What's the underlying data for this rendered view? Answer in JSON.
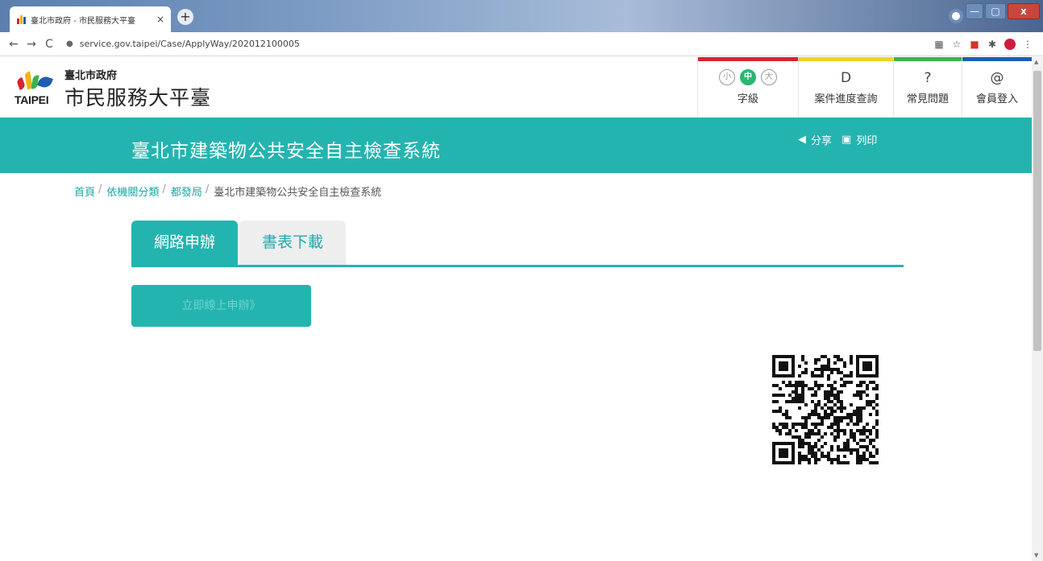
{
  "browser": {
    "tab_title": "臺北市政府 - 市民服務大平臺",
    "tab_close": "×",
    "new_tab": "+",
    "url": "service.gov.taipei/Case/ApplyWay/202012100005",
    "nav": {
      "back": "←",
      "forward": "→",
      "reload": "C",
      "lock": "🔒"
    },
    "window": {
      "minimize": "—",
      "maximize": "▢",
      "close": "x"
    }
  },
  "header": {
    "org_name": "臺北市政府",
    "site_name": "市民服務大平臺",
    "logo_word": "TAIPEI",
    "font_size": {
      "small": "小",
      "medium": "中",
      "large": "大",
      "label": "字級"
    },
    "case_query": {
      "icon": "D",
      "label": "案件進度查詢"
    },
    "faq": {
      "icon": "?",
      "label": "常見問題"
    },
    "login": {
      "icon": "@",
      "label": "會員登入"
    },
    "colorbar": [
      "#d9232d",
      "#f2d21b",
      "#3cb34a",
      "#1d5fb0"
    ]
  },
  "banner": {
    "title": "臺北市建築物公共安全自主檢查系統",
    "share": "分享",
    "print": "列印"
  },
  "breadcrumb": {
    "items": [
      "首頁",
      "依機關分類",
      "都發局"
    ],
    "sep": "/",
    "current": "臺北市建築物公共安全自主檢查系統"
  },
  "tabs": [
    {
      "label": "網路申辦",
      "active": true
    },
    {
      "label": "書表下載",
      "active": false
    }
  ],
  "apply_button": "立即線上申辦》",
  "colors": {
    "accent": "#24b4b0",
    "link": "#16a6a6",
    "active_font": "#2bb673"
  }
}
